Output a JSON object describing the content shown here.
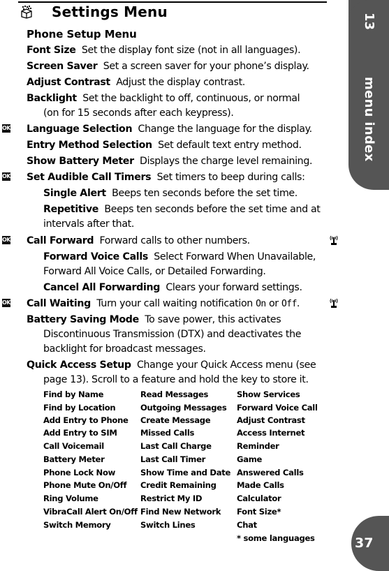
{
  "header": {
    "icon": "settings-box-icon",
    "title": "Settings Menu"
  },
  "section": {
    "title": "Phone Setup Menu"
  },
  "entries": [
    {
      "term": "Font Size",
      "desc": "Set the display font size (not in all languages).",
      "ok": false
    },
    {
      "term": "Screen Saver",
      "desc": "Set a screen saver for your phone’s display.",
      "ok": false
    },
    {
      "term": "Adjust Contrast",
      "desc": "Adjust the display contrast.",
      "ok": false
    },
    {
      "term": "Backlight",
      "desc": "Set the backlight to off, continuous, or normal",
      "desc2": "(on for 15 seconds after each keypress).",
      "ok": false
    },
    {
      "term": "Language Selection",
      "desc": "Change the language for the display.",
      "ok": true
    },
    {
      "term": "Entry Method Selection",
      "desc": "Set default text entry method.",
      "ok": false
    },
    {
      "term": "Show Battery Meter",
      "desc": "Displays the charge level remaining.",
      "ok": false
    },
    {
      "term": "Set Audible Call Timers",
      "desc": "Set timers to beep during calls:",
      "ok": true
    },
    {
      "term": "Single Alert",
      "desc": "Beeps ten seconds before the set time.",
      "sub": true
    },
    {
      "term": "Repetitive",
      "desc": "Beeps ten seconds before the set time and at",
      "desc2": "intervals after that.",
      "sub": true
    },
    {
      "term": "Call Forward",
      "desc": "Forward calls to other numbers.",
      "ok": true,
      "network": true
    },
    {
      "term": "Forward Voice Calls",
      "desc": "Select Forward When Unavailable,",
      "desc2": "Forward All Voice Calls, or Detailed Forwarding.",
      "sub": true
    },
    {
      "term": "Cancel All Forwarding",
      "desc": "Clears your forward settings.",
      "sub": true
    },
    {
      "term": "Call Waiting",
      "desc_pre": "Turn your call waiting notification",
      "opt_on": "On",
      "mid": "or",
      "opt_off": "Off",
      "end": ".",
      "ok": true,
      "network": true
    },
    {
      "term": "Battery Saving Mode",
      "desc": "To save power, this activates",
      "desc2": "Discontinuous Transmission (DTX) and deactivates the",
      "desc3": "backlight for broadcast messages.",
      "ok": false
    },
    {
      "term": "Quick Access Setup",
      "desc": "Change your Quick Access menu (see",
      "desc2": "page 13). Scroll to a feature and hold the key to store it.",
      "ok": false
    }
  ],
  "ok_icon_label": "OK",
  "quick_access": {
    "columns": [
      [
        "Find by Name",
        "Find by Location",
        "Add Entry to Phone",
        "Add Entry to SIM",
        "Call Voicemail",
        "Battery Meter",
        "Phone Lock Now",
        "Phone Mute On/Off",
        "Ring Volume",
        "VibraCall Alert On/Off",
        "Switch Memory"
      ],
      [
        "Read Messages",
        "Outgoing Messages",
        "Create Message",
        "Missed Calls",
        "Last Call Charge",
        "Last Call Timer",
        "Show Time and Date",
        "Credit Remaining",
        "Restrict My ID",
        "Find New Network",
        "Switch Lines"
      ],
      [
        "Show Services",
        "Forward Voice Call",
        "Adjust Contrast",
        "Access Internet",
        "Reminder",
        "Game",
        "Answered Calls",
        "Made Calls",
        "Calculator",
        "Font Size*",
        "Chat",
        "* some languages"
      ]
    ]
  },
  "side_tab": {
    "chapter_number": "13",
    "chapter_name": "menu index",
    "page_number": "37",
    "tab_color": "#555555"
  }
}
